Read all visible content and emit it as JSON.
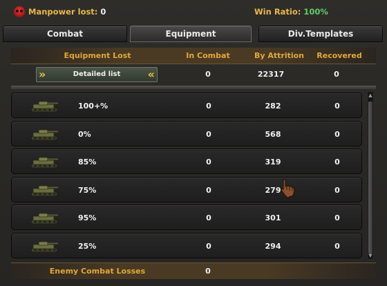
{
  "stats": {
    "manpower_label": "Manpower lost:",
    "manpower_value": "0",
    "winratio_label": "Win Ratio:",
    "winratio_value": "100%"
  },
  "tabs": [
    {
      "label": "Combat"
    },
    {
      "label": "Equipment"
    },
    {
      "label": "Div.Templates"
    }
  ],
  "columns": {
    "equipment_lost": "Equipment Lost",
    "in_combat": "In Combat",
    "by_attrition": "By Attrition",
    "recovered": "Recovered"
  },
  "summary": {
    "detail_label": "Detailed list",
    "in_combat": "0",
    "by_attrition": "22317",
    "recovered": "0"
  },
  "rows": [
    {
      "name": "100+%",
      "in_combat": "0",
      "by_attrition": "282",
      "recovered": "0",
      "icon": "tank-icon"
    },
    {
      "name": "0%",
      "in_combat": "0",
      "by_attrition": "568",
      "recovered": "0",
      "icon": "tank-icon"
    },
    {
      "name": "85%",
      "in_combat": "0",
      "by_attrition": "319",
      "recovered": "0",
      "icon": "tank-icon"
    },
    {
      "name": "75%",
      "in_combat": "0",
      "by_attrition": "279",
      "recovered": "0",
      "icon": "tank-icon"
    },
    {
      "name": "95%",
      "in_combat": "0",
      "by_attrition": "301",
      "recovered": "0",
      "icon": "tank-icon"
    },
    {
      "name": "25%",
      "in_combat": "0",
      "by_attrition": "294",
      "recovered": "0",
      "icon": "tank-icon"
    }
  ],
  "footer": {
    "label": "Enemy Combat Losses",
    "value": "0"
  },
  "colors": {
    "accent_gold": "#e2a83a",
    "ratio_green": "#5fd06a",
    "skull_red": "#e03a3a"
  }
}
